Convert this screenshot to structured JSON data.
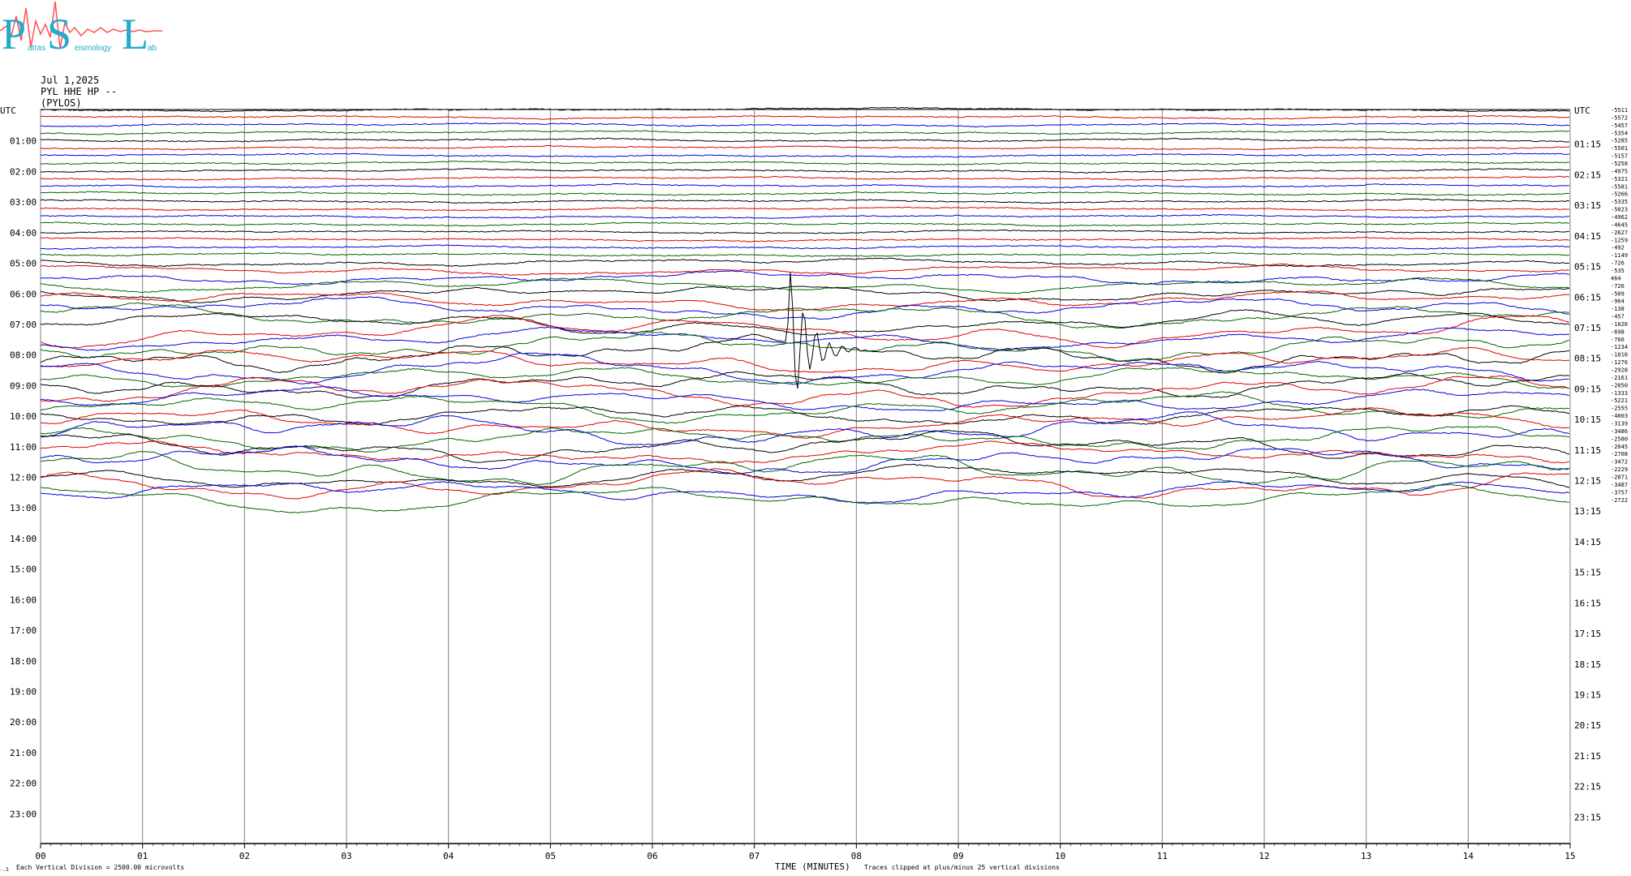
{
  "logo": {
    "letters": [
      "P",
      "S",
      "L"
    ],
    "small_words": [
      "atras",
      "eismology",
      "ab"
    ]
  },
  "header": {
    "date": "Jul 1,2025",
    "channel": "PYL HHE HP --",
    "station": "(PYLOS)"
  },
  "footer": {
    "scale_note": "Each Vertical Division = 2500.00 microvolts",
    "xlabel": "TIME (MINUTES)",
    "clip_note": "Traces clipped at plus/minus 25 vertical divisions",
    "corner_mark": "-.5"
  },
  "colors": {
    "trace_cycle": [
      "#000000",
      "#e00000",
      "#0000e0",
      "#006400"
    ],
    "grid": "#808080"
  },
  "chart_data": {
    "type": "line",
    "title": "",
    "xlabel": "TIME (MINUTES)",
    "ylabel": "UTC",
    "xlim": [
      0,
      15
    ],
    "x_ticks": [
      "00",
      "01",
      "02",
      "03",
      "04",
      "05",
      "06",
      "07",
      "08",
      "09",
      "10",
      "11",
      "12",
      "13",
      "14",
      "15"
    ],
    "left_hour_labels": [
      "UTC",
      "01:00",
      "02:00",
      "03:00",
      "04:00",
      "05:00",
      "06:00",
      "07:00",
      "08:00",
      "09:00",
      "10:00",
      "11:00",
      "12:00",
      "13:00",
      "14:00",
      "15:00",
      "16:00",
      "17:00",
      "18:00",
      "19:00",
      "20:00",
      "21:00",
      "22:00",
      "23:00"
    ],
    "right_hour_labels": [
      "UTC",
      "01:15",
      "02:15",
      "03:15",
      "04:15",
      "05:15",
      "06:15",
      "07:15",
      "08:15",
      "09:15",
      "10:15",
      "11:15",
      "12:15",
      "13:15",
      "14:15",
      "15:15",
      "16:15",
      "17:15",
      "18:15",
      "19:15",
      "20:15",
      "21:15",
      "22:15",
      "23:15"
    ],
    "trace_minutes": 15,
    "traces_per_hour": 4,
    "recorded_traces": 52,
    "trace_offsets": [
      -5511,
      -5572,
      -5457,
      -5354,
      -5285,
      -5501,
      -5157,
      -5258,
      -4975,
      -5321,
      -5581,
      -5266,
      -5335,
      -5023,
      -4962,
      -4645,
      -2627,
      -1259,
      -492,
      -1149,
      -726,
      -535,
      464,
      -726,
      -509,
      -964,
      -138,
      -457,
      -1026,
      -698,
      -760,
      -1234,
      -1016,
      -1276,
      -2928,
      -2161,
      -2050,
      -1333,
      -5221,
      -2555,
      -4003,
      -3139,
      -3486,
      -2580,
      -2045,
      -2708,
      -3472,
      -2229,
      -2871,
      -3487,
      -3757,
      -2722
    ],
    "units": "microvolts",
    "division_microvolts": 2500,
    "clip_divisions": 25,
    "event": {
      "trace_index": 32,
      "minute": 7.33,
      "note": "large green burst"
    }
  }
}
